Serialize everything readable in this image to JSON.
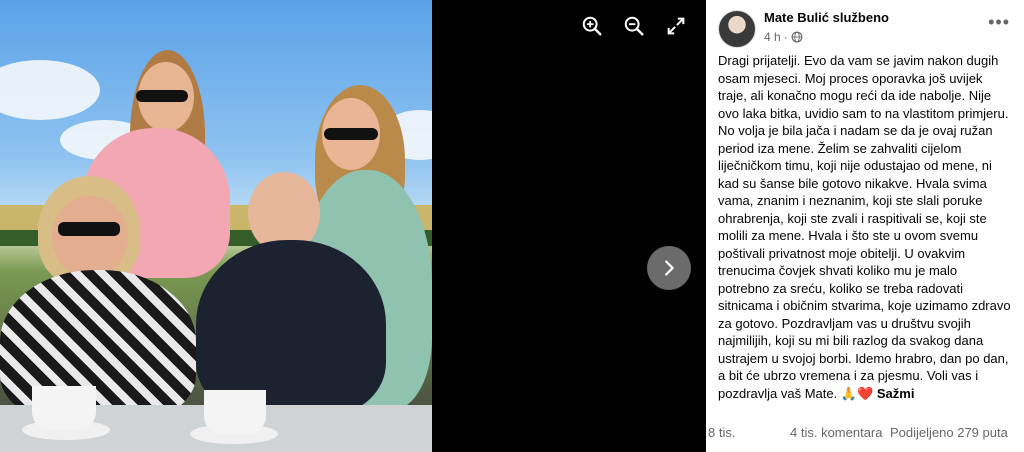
{
  "viewer": {
    "zoom_in_icon": "zoom-in-icon",
    "zoom_out_icon": "zoom-out-icon",
    "fullscreen_icon": "expand-icon",
    "next_icon": "chevron-right-icon"
  },
  "post": {
    "author": "Mate Bulić službeno",
    "time": "4 h",
    "separator": "·",
    "audience_icon": "globe-icon",
    "more_label": "•••",
    "text": "Dragi prijatelji. Evo da vam se javim nakon dugih osam mjeseci. Moj proces oporavka još uvijek traje, ali konačno mogu reći da ide nabolje. Nije ovo laka bitka, uvidio sam to na vlastitom primjeru. No volja je bila jača i nadam se da je ovaj ružan period iza mene. Želim se zahvaliti cijelom liječničkom timu, koji nije odustajao od mene, ni kad su šanse bile gotovo nikakve. Hvala svima vama, znanim i neznanim, koji ste slali poruke ohrabrenja, koji ste zvali i raspitivali se, koji ste molili za mene. Hvala i što ste u ovom svemu poštivali privatnost moje obitelji. U ovakvim trenucima čovjek shvati koliko mu je malo potrebno za sreću, koliko se treba radovati sitnicama i običnim stvarima, koje uzimamo zdravo za gotovo. Pozdravljam vas u društvu svojih najmilijih, koji su mi bili razlog da svakog dana ustrajem u svojoj borbi. Idemo hrabro, dan po dan, a bit će ubrzo vremena i za pjesmu. Voli vas i pozdravlja vaš Mate.",
    "emoji": "🙏❤️",
    "see_less": "Sažmi"
  },
  "stats": {
    "reactions": "8 tis.",
    "comments": "4 tis. komentara",
    "shares": "Podijeljeno 279 puta"
  }
}
